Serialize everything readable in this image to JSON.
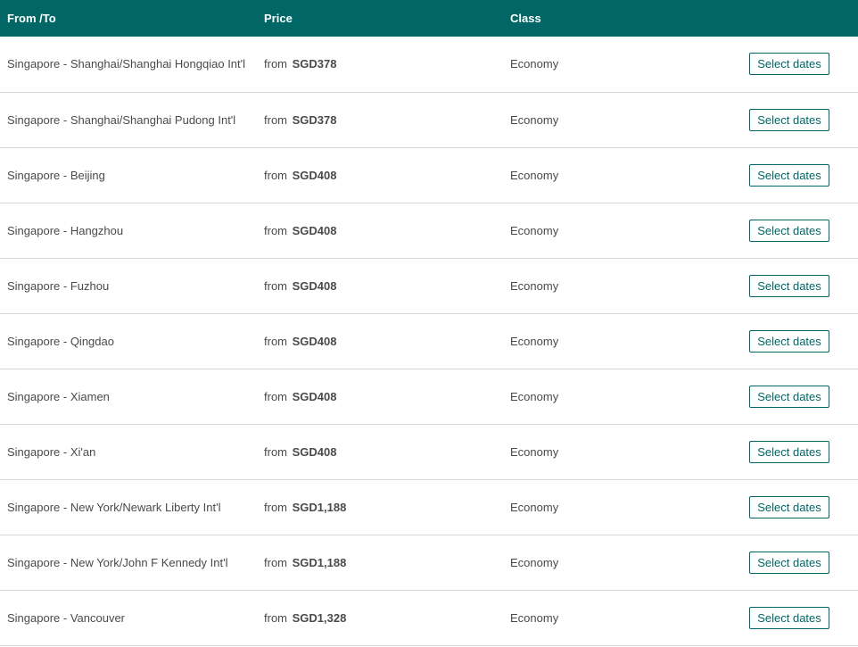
{
  "table": {
    "headers": {
      "route": "From /To",
      "price": "Price",
      "class": "Class"
    },
    "rows": [
      {
        "route": "Singapore - Shanghai/Shanghai Hongqiao Int'l",
        "price_prefix": "from",
        "price": "SGD378",
        "class": "Economy",
        "action": "Select dates"
      },
      {
        "route": "Singapore - Shanghai/Shanghai Pudong Int'l",
        "price_prefix": "from",
        "price": "SGD378",
        "class": "Economy",
        "action": "Select dates"
      },
      {
        "route": "Singapore - Beijing",
        "price_prefix": "from",
        "price": "SGD408",
        "class": "Economy",
        "action": "Select dates"
      },
      {
        "route": "Singapore - Hangzhou",
        "price_prefix": "from",
        "price": "SGD408",
        "class": "Economy",
        "action": "Select dates"
      },
      {
        "route": "Singapore - Fuzhou",
        "price_prefix": "from",
        "price": "SGD408",
        "class": "Economy",
        "action": "Select dates"
      },
      {
        "route": "Singapore - Qingdao",
        "price_prefix": "from",
        "price": "SGD408",
        "class": "Economy",
        "action": "Select dates"
      },
      {
        "route": "Singapore - Xiamen",
        "price_prefix": "from",
        "price": "SGD408",
        "class": "Economy",
        "action": "Select dates"
      },
      {
        "route": "Singapore - Xi'an",
        "price_prefix": "from",
        "price": "SGD408",
        "class": "Economy",
        "action": "Select dates"
      },
      {
        "route": "Singapore - New York/Newark Liberty Int'l",
        "price_prefix": "from",
        "price": "SGD1,188",
        "class": "Economy",
        "action": "Select dates"
      },
      {
        "route": "Singapore - New York/John F Kennedy Int'l",
        "price_prefix": "from",
        "price": "SGD1,188",
        "class": "Economy",
        "action": "Select dates"
      },
      {
        "route": "Singapore - Vancouver",
        "price_prefix": "from",
        "price": "SGD1,328",
        "class": "Economy",
        "action": "Select dates"
      }
    ]
  },
  "colors": {
    "header_bg": "#006666",
    "accent": "#006666",
    "divider": "#d6d6d6"
  }
}
